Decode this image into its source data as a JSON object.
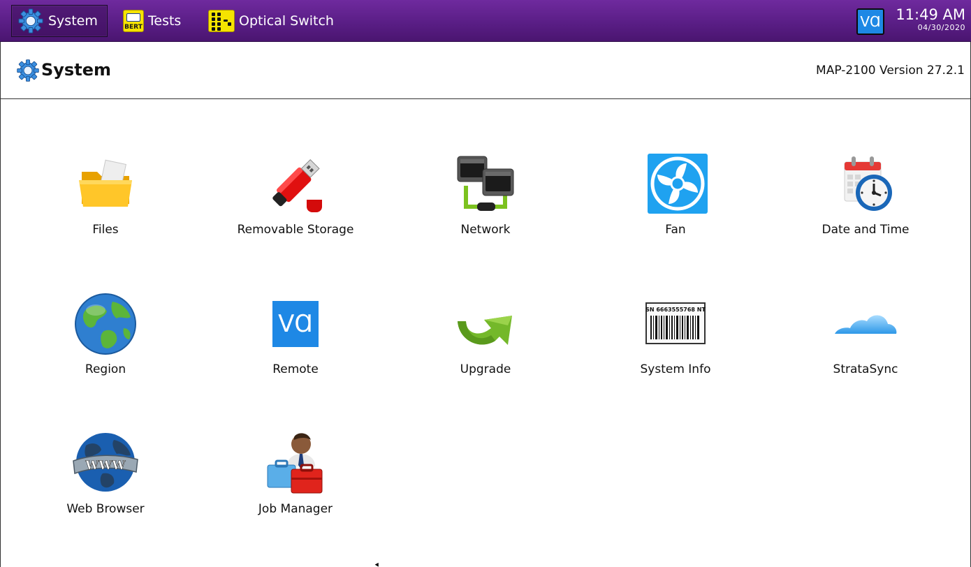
{
  "topbar": {
    "tabs": [
      {
        "label": "System",
        "icon": "gear-icon",
        "active": true
      },
      {
        "label": "Tests",
        "icon": "bert-icon",
        "icon_text": "BERT"
      },
      {
        "label": "Optical Switch",
        "icon": "optical-switch-icon"
      }
    ],
    "vnc_label": "VⱭ",
    "time": "11:49 AM",
    "date": "04/30/2020",
    "colors": {
      "bar": "#5a1e86",
      "accent": "#1e88e5"
    }
  },
  "header": {
    "title": "System",
    "version": "MAP-2100 Version 27.2.1"
  },
  "tiles": [
    {
      "label": "Files",
      "icon": "folder-icon"
    },
    {
      "label": "Removable Storage",
      "icon": "usb-drive-icon"
    },
    {
      "label": "Network",
      "icon": "network-icon"
    },
    {
      "label": "Fan",
      "icon": "fan-icon"
    },
    {
      "label": "Date and Time",
      "icon": "calendar-clock-icon"
    },
    {
      "label": "Region",
      "icon": "globe-icon"
    },
    {
      "label": "Remote",
      "icon": "vnc-icon",
      "icon_text": "VⱭ"
    },
    {
      "label": "Upgrade",
      "icon": "upgrade-arrow-icon"
    },
    {
      "label": "System Info",
      "icon": "barcode-icon",
      "icon_text": "SN 6663555768 NT"
    },
    {
      "label": "StrataSync",
      "icon": "cloud-icon"
    },
    {
      "label": "Web Browser",
      "icon": "www-globe-icon",
      "icon_text": "WWW"
    },
    {
      "label": "Job Manager",
      "icon": "job-manager-icon"
    }
  ]
}
